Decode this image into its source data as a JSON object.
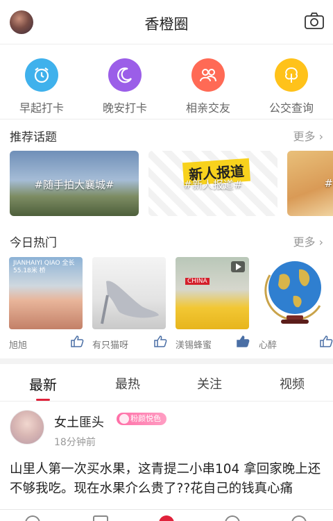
{
  "header": {
    "title": "香橙圈",
    "avatar_icon": "user-avatar",
    "camera_icon": "camera-icon"
  },
  "quick_actions": [
    {
      "label": "早起打卡",
      "icon": "alarm-clock-icon",
      "color": "#3fb1ec"
    },
    {
      "label": "晚安打卡",
      "icon": "moon-icon",
      "color": "#9b5ee8"
    },
    {
      "label": "相亲交友",
      "icon": "people-icon",
      "color": "#ff6a55"
    },
    {
      "label": "公交查询",
      "icon": "tree-icon",
      "color": "#ffc21a"
    }
  ],
  "topics": {
    "title": "推荐话题",
    "more": "更多",
    "items": [
      {
        "tag": "#随手拍大襄城#"
      },
      {
        "tag": "#新人报道#",
        "image_text": "新人报道"
      },
      {
        "tag": "#"
      }
    ]
  },
  "hot": {
    "title": "今日热门",
    "more": "更多",
    "items": [
      {
        "name": "旭旭",
        "image_text": "JIANHAIYI QIAO 全长55.18米 桥"
      },
      {
        "name": "有只猫呀"
      },
      {
        "name": "渼锡蜂蜜",
        "image_text": "CHINA"
      },
      {
        "name": "心醉"
      }
    ]
  },
  "tabs": [
    "最新",
    "最热",
    "关注",
    "视频"
  ],
  "active_tab": "最新",
  "post": {
    "author": "女土匪头",
    "badge": "粉颜悦色",
    "time": "18分钟前",
    "body": "山里人第一次买水果，这青提二小串104  拿回家晚上还不够我吃。现在水果介么贵了??花自己的钱真心痛"
  },
  "colors": {
    "accent": "#e0223b",
    "divider": "#ececec"
  }
}
